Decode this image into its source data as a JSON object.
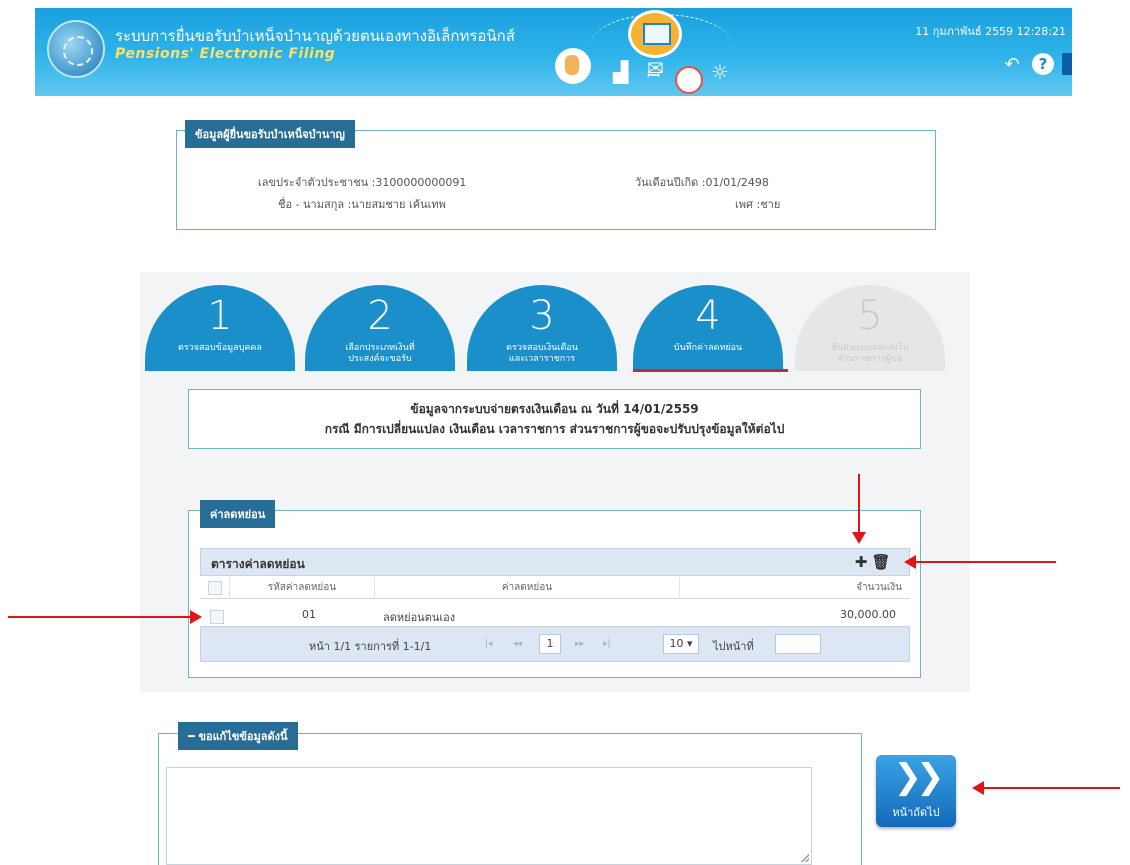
{
  "header": {
    "title_th": "ระบบการยื่นขอรับบำเหน็จบำนาญด้วยตนเองทางอิเล็กทรอนิกส์",
    "title_en": "Pensions' Electronic Filing",
    "datetime": "11 กุมภาพันธ์ 2559 12:28:21"
  },
  "applicant": {
    "legend": "ข้อมูลผู้ยื่นขอรับบำเหน็จบำนาญ",
    "id_label": "เลขประจำตัวประชาชน :3100000000091",
    "name_label": "ชื่อ - นามสกุล :นายสมชาย เค้นเทพ",
    "dob_label": "วันเดือนปีเกิด :01/01/2498",
    "gender_label": "เพศ :ชาย"
  },
  "steps": [
    {
      "number": "1",
      "label": "ตรวจสอบข้อมูลบุคคล"
    },
    {
      "number": "2",
      "label": "เลือกประเภทเงินที่ประสงค์จะขอรับ"
    },
    {
      "number": "3",
      "label": "ตรวจสอบเงินเดือนและเวลาราชการ"
    },
    {
      "number": "4",
      "label": "บันทึกค่าลดหย่อน"
    },
    {
      "number": "5",
      "label": "ยืนยันแบบและส่งไปส่วนราชการผู้ขอ"
    }
  ],
  "notice": {
    "line1": "ข้อมูลจากระบบจ่ายตรงเงินเดือน ณ วันที่ 14/01/2559",
    "line2": "กรณี มีการเปลี่ยนแปลง เงินเดือน เวลาราชการ ส่วนราชการผู้ขอจะปรับปรุงข้อมูลให้ต่อไป"
  },
  "deduction": {
    "legend": "ค่าลดหย่อน",
    "table_caption": "ตารางค่าลดหย่อน",
    "columns": [
      "รหัสค่าลดหย่อน",
      "ค่าลดหย่อน",
      "จำนวนเงิน"
    ],
    "rows": [
      {
        "code": "01",
        "name": "ลดหย่อนตนเอง",
        "amount": "30,000.00"
      }
    ],
    "pager": {
      "info": "หน้า 1/1 รายการที่ 1-1/1",
      "page": "1",
      "page_size": "10 ▾",
      "goto_label": "ไปหน้าที่"
    }
  },
  "comment": {
    "legend": "ขอแก้ไขข้อมูลดังนี้",
    "value": ""
  },
  "next_button": {
    "label": "หน้าถัดไป"
  },
  "icons": [
    "back-arrow-icon",
    "help-icon",
    "plus-icon",
    "trash-icon",
    "double-chevron-right-icon"
  ],
  "colors": {
    "header_bg": "#1aa0dd",
    "step_active": "#1a8fc9",
    "legend_bg": "#286d96",
    "annotation_arrow": "#e2141b"
  }
}
